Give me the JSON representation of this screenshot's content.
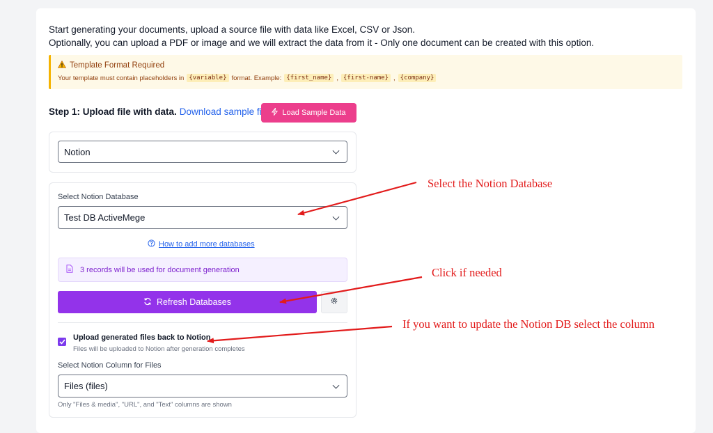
{
  "intro": {
    "line1": "Start generating your documents, upload a source file with data like Excel, CSV or Json.",
    "line2": "Optionally, you can upload a PDF or image and we will extract the data from it - Only one document can be created with this option."
  },
  "warning": {
    "title": "Template Format Required",
    "body_prefix": "Your template must contain placeholders in",
    "code_variable": "{variable}",
    "body_middle": "format. Example:",
    "ex1": "{first_name}",
    "sep1": ",",
    "ex2": "{first-name}",
    "sep2": ",",
    "ex3": "{company}",
    "color": "#f5b301"
  },
  "step1": {
    "label": "Step 1: Upload file with data.",
    "link": "Download sample file.",
    "sample_button": "Load Sample Data"
  },
  "source_select": {
    "value": "Notion"
  },
  "notion": {
    "db_label": "Select Notion Database",
    "db_value": "Test DB ActiveMege",
    "help_link": "How to add more databases",
    "records_info": "3 records will be used for document generation",
    "refresh_button": "Refresh Databases",
    "upload_checkbox_label": "Upload generated files back to Notion",
    "upload_checkbox_checked": true,
    "upload_checkbox_sub": "Files will be uploaded to Notion after generation completes",
    "column_label": "Select Notion Column for Files",
    "column_value": "Files (files)",
    "column_note": "Only \"Files & media\", \"URL\", and \"Text\" columns are shown"
  },
  "annotations": {
    "a1": "Select the Notion Database",
    "a2": "Click if needed",
    "a3": "If you want to update the Notion DB select the column",
    "color": "#e21b1b"
  },
  "colors": {
    "accent_purple": "#9333ea",
    "pink_button": "#ec3e8c",
    "link_blue": "#2563eb"
  }
}
